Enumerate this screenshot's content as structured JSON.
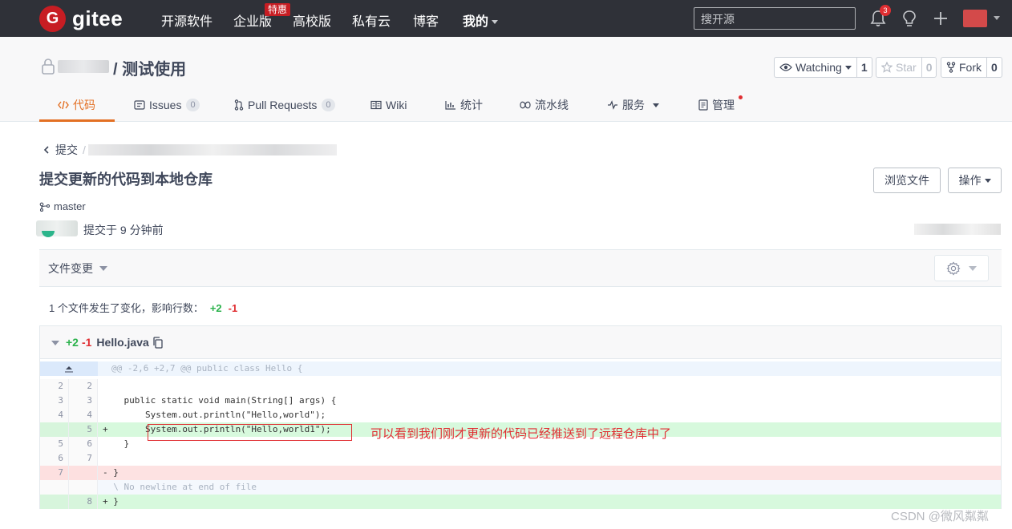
{
  "topnav": {
    "logo_letter": "G",
    "logo_text": "gitee",
    "items": [
      "开源软件",
      "企业版",
      "高校版",
      "私有云",
      "博客",
      "我的"
    ],
    "enterprise_badge": "特惠",
    "search_placeholder": "搜开源",
    "notification_count": "3"
  },
  "project": {
    "title": "/ 测试使用",
    "watch_label": "Watching",
    "watch_count": "1",
    "star_label": "Star",
    "star_count": "0",
    "fork_label": "Fork",
    "fork_count": "0"
  },
  "tabs": [
    {
      "label": "代码",
      "icon": "code-icon"
    },
    {
      "label": "Issues",
      "count": "0",
      "icon": "issues-icon"
    },
    {
      "label": "Pull Requests",
      "count": "0",
      "icon": "pull-request-icon"
    },
    {
      "label": "Wiki",
      "icon": "wiki-icon"
    },
    {
      "label": "统计",
      "icon": "stats-icon"
    },
    {
      "label": "流水线",
      "icon": "pipeline-icon"
    },
    {
      "label": "服务",
      "icon": "service-icon"
    },
    {
      "label": "管理",
      "icon": "manage-icon"
    }
  ],
  "commit": {
    "breadcrumb": "提交",
    "title": "提交更新的代码到本地仓库",
    "browse_button": "浏览文件",
    "actions_button": "操作",
    "branch": "master",
    "time": "提交于 9 分钟前"
  },
  "files": {
    "label": "文件变更",
    "summary_text": "1 个文件发生了变化，影响行数：",
    "summary_add": "+2",
    "summary_del": "-1"
  },
  "diff": {
    "add": "+2",
    "del": "-1",
    "filename": "Hello.java",
    "hunk": "@@ -2,6 +2,7 @@ public class Hello {",
    "lines": [
      {
        "old": "2",
        "new": "2",
        "type": "ctx",
        "text": ""
      },
      {
        "old": "3",
        "new": "3",
        "type": "ctx",
        "text": "    public static void main(String[] args) {"
      },
      {
        "old": "4",
        "new": "4",
        "type": "ctx",
        "text": "        System.out.println(\"Hello,world\");"
      },
      {
        "old": "",
        "new": "5",
        "type": "add",
        "text": "+       System.out.println(\"Hello,world1\");"
      },
      {
        "old": "5",
        "new": "6",
        "type": "ctx",
        "text": "    }"
      },
      {
        "old": "6",
        "new": "7",
        "type": "ctx",
        "text": ""
      },
      {
        "old": "7",
        "new": "",
        "type": "del",
        "text": "- }"
      },
      {
        "old": "",
        "new": "",
        "type": "meta",
        "text": "  \\ No newline at end of file"
      },
      {
        "old": "",
        "new": "8",
        "type": "add",
        "text": "+ }"
      }
    ]
  },
  "annotation": "可以看到我们刚才更新的代码已经推送到了远程仓库中了",
  "watermark": "CSDN @微风粼粼",
  "colors": {
    "nav_bg": "#2f3138",
    "brand_red": "#c71d23",
    "accent_orange": "#e37024",
    "add_green": "#2bb24c",
    "del_red": "#e02e32"
  }
}
